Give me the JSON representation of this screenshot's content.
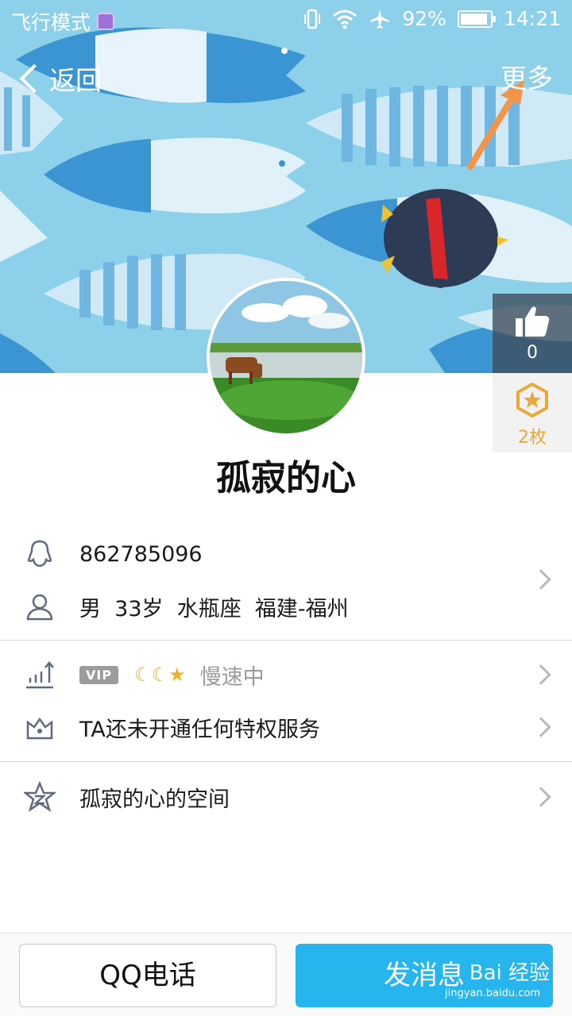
{
  "status_bar": {
    "mode_text": "飞行模式",
    "battery_percent": "92%",
    "battery_level": 0.92,
    "time": "14:21"
  },
  "nav": {
    "back_label": "返回",
    "more_label": "更多"
  },
  "side": {
    "like_count": "0",
    "badge_count": "2枚"
  },
  "profile": {
    "nickname": "孤寂的心",
    "qq_number": "862785096",
    "info_parts": [
      "男",
      "33岁",
      "水瓶座",
      "福建-福州"
    ],
    "vip_tag": "VIP",
    "speed_text": "慢速中",
    "privilege_text": "TA还未开通任何特权服务",
    "space_text": "孤寂的心的空间"
  },
  "bottom": {
    "call_label": "QQ电话",
    "message_label": "发消息"
  },
  "watermark": {
    "main": "Bai 经验",
    "sub": "jingyan.baidu.com"
  },
  "colors": {
    "banner_bg": "#8dd0ea",
    "accent_blue": "#27b5ee",
    "badge_gold": "#e8a93a"
  }
}
